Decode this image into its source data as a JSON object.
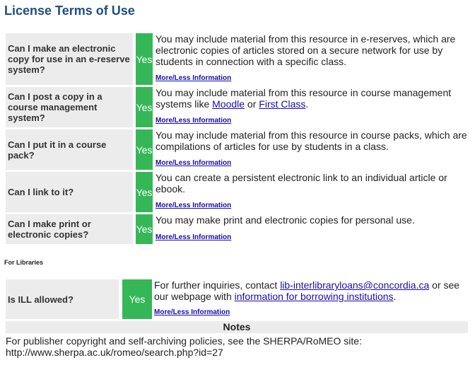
{
  "page": {
    "title": "License Terms of Use"
  },
  "terms": [
    {
      "question": "Can I make an electronic copy for use in an e-reserve system?",
      "answer": "Yes",
      "text": "You may include material from this resource in e-reserves, which are electronic copies of articles stored on a secure network for use by students in connection with a specific class.",
      "more_label": "More/Less Information"
    },
    {
      "question": "Can I post a copy in a course management system?",
      "answer": "Yes",
      "text_before": "You may include material from this resource in course management systems like ",
      "link1": "Moodle",
      "text_mid": " or ",
      "link2": "First Class",
      "text_after": ".",
      "more_label": "More/Less Information"
    },
    {
      "question": "Can I put it in a course pack?",
      "answer": "Yes",
      "text": "You may include material from this resource in course packs, which are compilations of articles for use by students in a class.",
      "more_label": "More/Less Information"
    },
    {
      "question": "Can I link to it?",
      "answer": "Yes",
      "text": "You can create a persistent electronic link to an individual article or ebook.",
      "more_label": "More/Less Information"
    },
    {
      "question": "Can I make print or electronic copies?",
      "answer": "Yes",
      "text": "You may make print and electronic copies for personal use.",
      "more_label": "More/Less Information"
    }
  ],
  "libraries": {
    "section_label": "For Libraries",
    "question": "Is ILL allowed?",
    "answer": "Yes",
    "text_before": "For further inquiries, contact ",
    "email_link": "lib-interlibraryloans@concordia.ca",
    "text_mid": " or see our webpage with ",
    "info_link": "information for borrowing institutions",
    "text_after": ".",
    "more_label": "More/Less Information"
  },
  "notes": {
    "header": "Notes",
    "body": "For publisher copyright and self-archiving policies, see the SHERPA/RoMEO site: http://www.sherpa.ac.uk/romeo/search.php?id=27"
  },
  "colors": {
    "title": "#1f4f7e",
    "yes_badge": "#35b757",
    "question_bg": "#ececec",
    "link": "#1a0dab"
  }
}
